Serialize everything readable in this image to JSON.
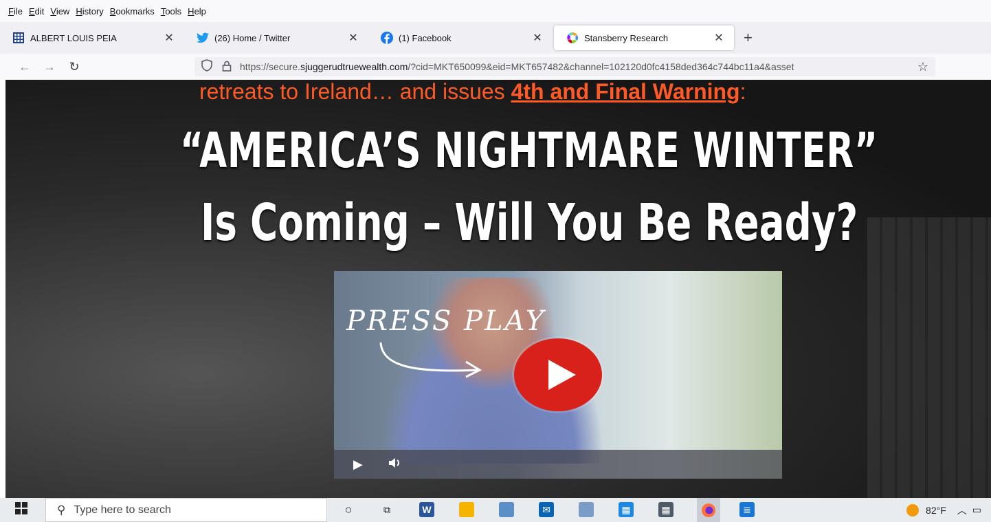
{
  "menubar": {
    "items": [
      "File",
      "Edit",
      "View",
      "History",
      "Bookmarks",
      "Tools",
      "Help"
    ]
  },
  "tabs": [
    {
      "label": "ALBERT LOUIS PEIA",
      "icon": "grid-icon",
      "active": false
    },
    {
      "label": "(26) Home / Twitter",
      "icon": "twitter-icon",
      "active": false
    },
    {
      "label": "(1) Facebook",
      "icon": "facebook-icon",
      "active": false
    },
    {
      "label": "Stansberry Research",
      "icon": "stansberry-icon",
      "active": true
    }
  ],
  "newtab_label": "+",
  "nav": {
    "url_prefix": "https://secure.",
    "url_domain": "sjuggerudtruewealth.com",
    "url_rest": "/?cid=MKT650099&eid=MKT657482&channel=102120d0fc4158ded364c744bc11a4&asset"
  },
  "page": {
    "headline_top_plain": "retreats to Ireland… and issues ",
    "headline_top_warn": "4th and Final Warning",
    "headline_top_colon": ":",
    "title_line1": "“AMERICA’S NIGHTMARE WINTER”",
    "title_line2": "Is Coming – Will You Be Ready?",
    "video_overlay": "PRESS PLAY",
    "accent_color": "#ff5a26",
    "play_color": "#d8211a"
  },
  "taskbar": {
    "search_placeholder": "Type here to search",
    "temperature": "82°F",
    "apps": [
      "cortana-icon",
      "task-view-icon",
      "word-icon",
      "file-explorer-icon",
      "notepad-icon",
      "mail-icon",
      "paint-icon",
      "calendar-icon",
      "calculator-icon",
      "firefox-icon",
      "document-icon"
    ]
  }
}
